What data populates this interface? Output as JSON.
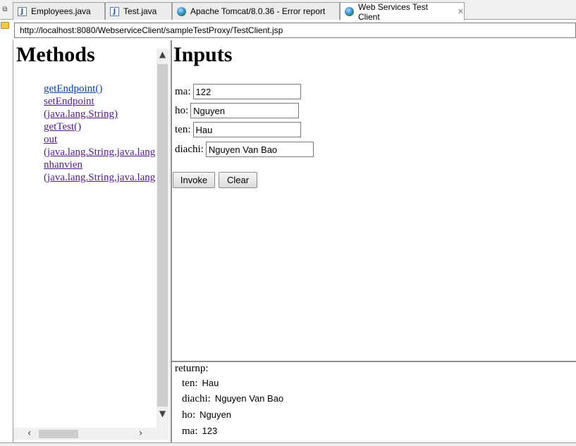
{
  "tabs": [
    {
      "label": "Employees.java",
      "icon": "java-file-icon"
    },
    {
      "label": "Test.java",
      "icon": "java-file-icon"
    },
    {
      "label": "Apache Tomcat/8.0.36 - Error report",
      "icon": "globe-icon"
    },
    {
      "label": "Web Services Test Client",
      "icon": "globe-icon",
      "active": true
    }
  ],
  "address": {
    "url": "http://localhost:8080/WebserviceClient/sampleTestProxy/TestClient.jsp"
  },
  "methods": {
    "title": "Methods",
    "items": [
      {
        "name": "getEndpoint()",
        "params": ""
      },
      {
        "name": "setEndpoint",
        "params": "(java.lang.String)"
      },
      {
        "name": "getTest()",
        "params": ""
      },
      {
        "name": "out",
        "params": "(java.lang.String,java.lang"
      },
      {
        "name": "nhanvien",
        "params": "(java.lang.String,java.lang"
      }
    ]
  },
  "inputs": {
    "title": "Inputs",
    "fields": [
      {
        "label": "ma:",
        "value": "122"
      },
      {
        "label": "ho:",
        "value": "Nguyen"
      },
      {
        "label": "ten:",
        "value": "Hau"
      },
      {
        "label": "diachi:",
        "value": "Nguyen Van Bao"
      }
    ],
    "invoke_label": "Invoke",
    "clear_label": "Clear"
  },
  "result": {
    "title": "returnp:",
    "rows": [
      {
        "label": "ten:",
        "value": "Hau"
      },
      {
        "label": "diachi:",
        "value": "Nguyen Van Bao"
      },
      {
        "label": "ho:",
        "value": "Nguyen"
      },
      {
        "label": "ma:",
        "value": "123"
      }
    ]
  },
  "colors": {
    "link_visited": "#551a8b",
    "link_unvisited": "#0645ad",
    "tabstrip_bg": "#f0f0f0",
    "scroll_thumb": "#cdcdcd"
  }
}
